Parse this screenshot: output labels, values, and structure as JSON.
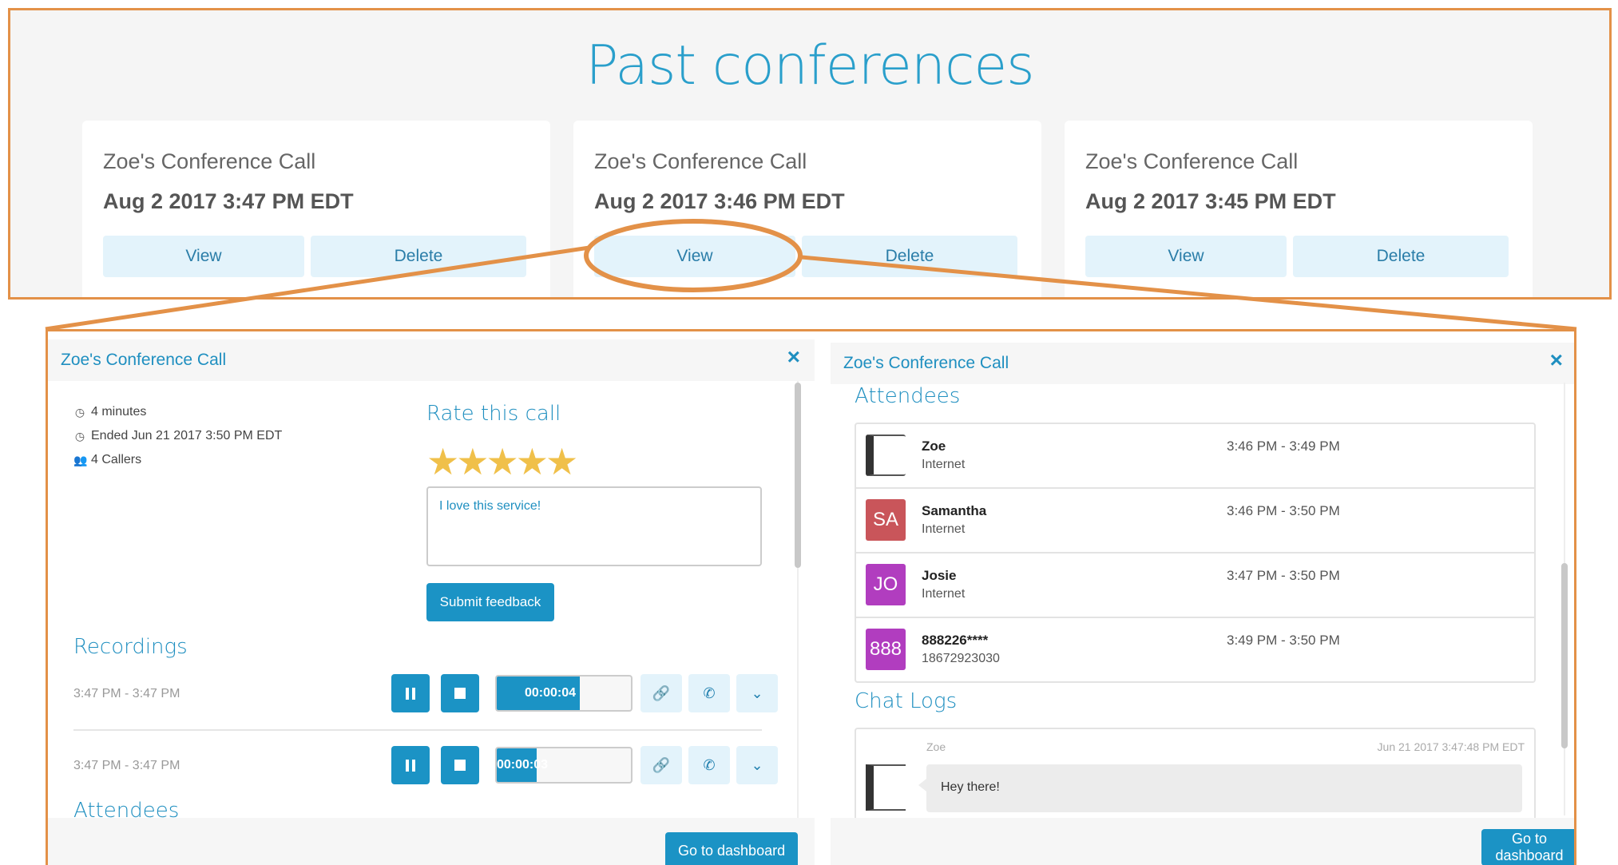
{
  "header": {
    "title": "Past conferences"
  },
  "conferences": [
    {
      "name": "Zoe's Conference Call",
      "date": "Aug 2 2017 3:47 PM EDT",
      "view_label": "View",
      "delete_label": "Delete"
    },
    {
      "name": "Zoe's Conference Call",
      "date": "Aug 2 2017 3:46 PM EDT",
      "view_label": "View",
      "delete_label": "Delete"
    },
    {
      "name": "Zoe's Conference Call",
      "date": "Aug 2 2017 3:45 PM EDT",
      "view_label": "View",
      "delete_label": "Delete"
    }
  ],
  "left_modal": {
    "title": "Zoe's Conference Call",
    "close_glyph": "×",
    "duration": "4 minutes",
    "ended": "Ended Jun 21 2017 3:50 PM EDT",
    "callers": "4 Callers",
    "rate_heading": "Rate this call",
    "stars": "★★★★★",
    "rating": 5,
    "feedback_text": "I love this service!",
    "submit_label": "Submit feedback",
    "recordings_heading": "Recordings",
    "recordings": [
      {
        "time": "3:47 PM - 3:47 PM",
        "elapsed": "00:00:04",
        "progress": 0.62
      },
      {
        "time": "3:47 PM - 3:47 PM",
        "elapsed": "00:00:03",
        "progress": 0.3
      }
    ],
    "attendees_heading": "Attendees",
    "dashboard_label": "Go to dashboard"
  },
  "right_modal": {
    "title": "Zoe's Conference Call",
    "close_glyph": "×",
    "attendees_heading": "Attendees",
    "attendees": [
      {
        "initials": "",
        "avatar_color": "",
        "name": "Zoe",
        "via": "Internet",
        "time": "3:46 PM - 3:49 PM"
      },
      {
        "initials": "SA",
        "avatar_color": "#c9555a",
        "name": "Samantha",
        "via": "Internet",
        "time": "3:46 PM - 3:50 PM"
      },
      {
        "initials": "JO",
        "avatar_color": "#b13dbf",
        "name": "Josie",
        "via": "Internet",
        "time": "3:47 PM - 3:50 PM"
      },
      {
        "initials": "888",
        "avatar_color": "#b13dbf",
        "name": "888226****",
        "via": "18672923030",
        "time": "3:49 PM - 3:50 PM"
      }
    ],
    "chat_heading": "Chat Logs",
    "chat": {
      "sender": "Zoe",
      "timestamp": "Jun 21 2017 3:47:48 PM EDT",
      "message": "Hey there!"
    },
    "dashboard_label": "Go to dashboard"
  },
  "colors": {
    "accent": "#1b93c5",
    "callout": "#e39148",
    "star": "#f0c04a"
  }
}
